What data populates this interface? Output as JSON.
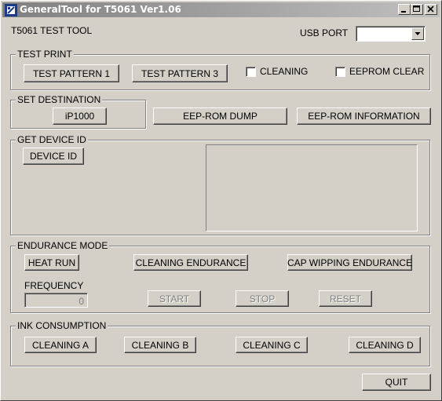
{
  "window": {
    "title": "GeneralTool for T5061 Ver1.06",
    "app_label": "T5061 TEST TOOL",
    "usb_port_label": "USB PORT",
    "usb_port_value": ""
  },
  "test_print": {
    "title": "TEST PRINT",
    "pattern1_label": "TEST PATTERN 1",
    "pattern3_label": "TEST PATTERN 3",
    "cleaning_label": "CLEANING",
    "eeprom_clear_label": "EEPROM CLEAR",
    "cleaning_checked": false,
    "eeprom_clear_checked": false
  },
  "set_destination": {
    "title": "SET DESTINATION",
    "destination_label": "iP1000"
  },
  "eeprom": {
    "dump_label": "EEP-ROM DUMP",
    "information_label": "EEP-ROM INFORMATION"
  },
  "device_id": {
    "title": "GET DEVICE ID",
    "button_label": "DEVICE ID",
    "output": ""
  },
  "endurance": {
    "title": "ENDURANCE MODE",
    "heat_run_label": "HEAT RUN",
    "cleaning_endurance_label": "CLEANING ENDURANCE",
    "cap_wipping_label": "CAP WIPPING ENDURANCE",
    "frequency_label": "FREQUENCY",
    "frequency_value": "0",
    "start_label": "START",
    "stop_label": "STOP",
    "reset_label": "RESET"
  },
  "ink": {
    "title": "INK CONSUMPTION",
    "cleaning_a": "CLEANING A",
    "cleaning_b": "CLEANING B",
    "cleaning_c": "CLEANING C",
    "cleaning_d": "CLEANING D"
  },
  "footer": {
    "quit_label": "QUIT"
  }
}
